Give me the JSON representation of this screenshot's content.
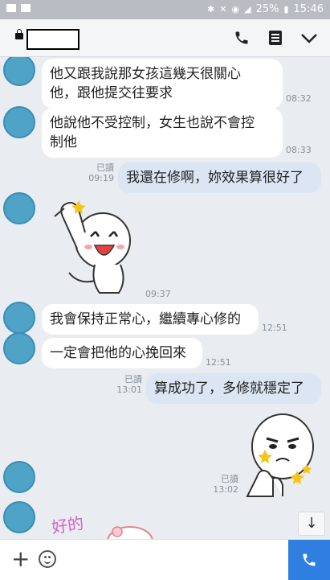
{
  "status_bar": {
    "battery": "25%",
    "time": "15:46"
  },
  "header": {
    "icons": [
      "lock-icon",
      "phone-icon",
      "menu-icon",
      "chevron-down-icon"
    ]
  },
  "messages": [
    {
      "text_line1": "他又跟我說那女孩這幾天很關心",
      "text_line2": "他，跟他提交往要求",
      "time": "08:32"
    },
    {
      "text_line1": "他說他不受控制，女生也說不會控",
      "text_line2": "制他",
      "time": "08:33"
    },
    {
      "text": "我還在修啊，妳效果算很好了",
      "read": "已讀",
      "time": "09:19"
    },
    {
      "sticker": "cheering-sticker",
      "time": "09:37"
    },
    {
      "text": "我會保持正常心，繼續專心修的",
      "time": "12:51"
    },
    {
      "text": "一定會把他的心挽回來",
      "time": "12:51"
    },
    {
      "text": "算成功了，多修就穩定了",
      "read": "已讀",
      "time": "13:01"
    },
    {
      "sticker": "thumbs-up-sticker",
      "read": "已讀",
      "time": "13:02"
    },
    {
      "sticker": "good-sticker",
      "sticker_text": "好的"
    }
  ],
  "bottom_bar": {
    "icons": [
      "plus-icon",
      "emoji-icon",
      "call-icon"
    ]
  },
  "colors": {
    "background": "#e9ecf1",
    "my_bubble": "#dce5f3",
    "avatar": "#4fa3c7",
    "call_button": "#2f7fe0"
  }
}
